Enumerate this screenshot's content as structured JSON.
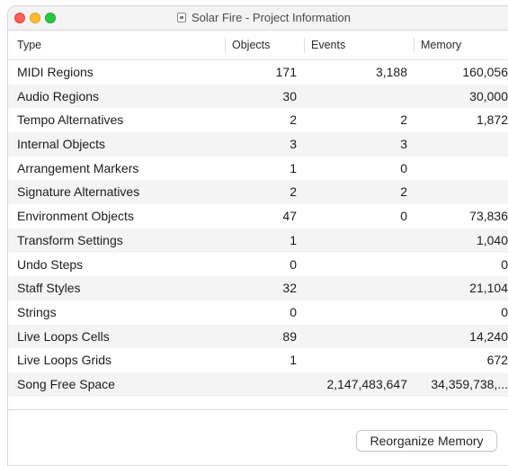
{
  "window": {
    "title": "Solar Fire - Project Information"
  },
  "columns": {
    "type": "Type",
    "objects": "Objects",
    "events": "Events",
    "memory": "Memory"
  },
  "rows": [
    {
      "type": "MIDI Regions",
      "objects": "171",
      "events": "3,188",
      "memory": "160,056"
    },
    {
      "type": "Audio Regions",
      "objects": "30",
      "events": "",
      "memory": "30,000"
    },
    {
      "type": "Tempo Alternatives",
      "objects": "2",
      "events": "2",
      "memory": "1,872"
    },
    {
      "type": "Internal Objects",
      "objects": "3",
      "events": "3",
      "memory": ""
    },
    {
      "type": "Arrangement Markers",
      "objects": "1",
      "events": "0",
      "memory": ""
    },
    {
      "type": "Signature Alternatives",
      "objects": "2",
      "events": "2",
      "memory": ""
    },
    {
      "type": "Environment Objects",
      "objects": "47",
      "events": "0",
      "memory": "73,836"
    },
    {
      "type": "Transform Settings",
      "objects": "1",
      "events": "",
      "memory": "1,040"
    },
    {
      "type": "Undo Steps",
      "objects": "0",
      "events": "",
      "memory": "0"
    },
    {
      "type": "Staff Styles",
      "objects": "32",
      "events": "",
      "memory": "21,104"
    },
    {
      "type": "Strings",
      "objects": "0",
      "events": "",
      "memory": "0"
    },
    {
      "type": "Live Loops Cells",
      "objects": "89",
      "events": "",
      "memory": "14,240"
    },
    {
      "type": "Live Loops Grids",
      "objects": "1",
      "events": "",
      "memory": "672"
    },
    {
      "type": "Song Free Space",
      "objects": "",
      "events": "2,147,483,647",
      "memory": "34,359,738,..."
    }
  ],
  "footer": {
    "reorganize_label": "Reorganize Memory"
  }
}
